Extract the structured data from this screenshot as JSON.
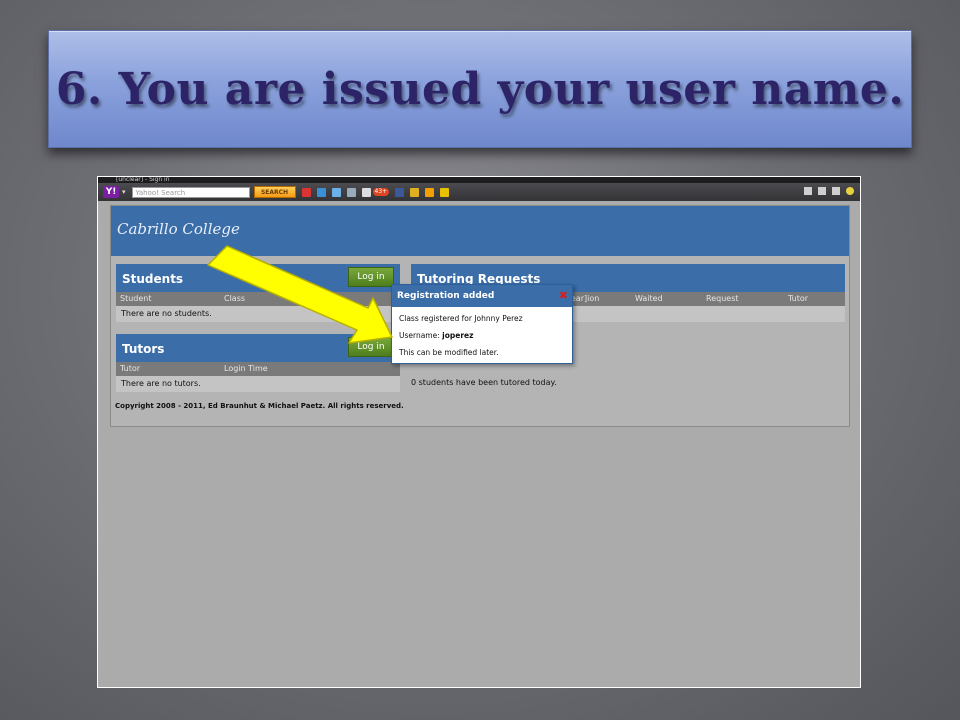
{
  "slide": {
    "title": "6. You are issued your user name."
  },
  "browser": {
    "window_title": "[unclear] - Sign in",
    "search_placeholder": "Yahoo! Search",
    "search_button": "SEARCH",
    "mail_badge": "43+"
  },
  "site": {
    "logo": "Cabrillo College",
    "students_panel": {
      "title": "Students",
      "login": "Log in",
      "columns": [
        "Student",
        "Class"
      ],
      "empty": "There are no students."
    },
    "tutors_panel": {
      "title": "Tutors",
      "login": "Log in",
      "columns": [
        "Tutor",
        "Login Time"
      ],
      "empty": "There are no tutors."
    },
    "requests_panel": {
      "title": "Tutoring Requests",
      "columns": [
        "[unclear]ion",
        "Waited",
        "Request",
        "Tutor"
      ],
      "today": "0 students have been tutored today."
    },
    "footer": "Copyright 2008 - 2011, Ed Braunhut & Michael Paetz. All rights reserved."
  },
  "dialog": {
    "title": "Registration added",
    "line1": "Class registered for Johnny Perez",
    "username_label": "Username:",
    "username_value": "joperez",
    "line3": "This can be modified later."
  },
  "colors": {
    "header_blue": "#3b6ea8",
    "login_green": "#5a8a26",
    "arrow_yellow": "#ffff00"
  }
}
